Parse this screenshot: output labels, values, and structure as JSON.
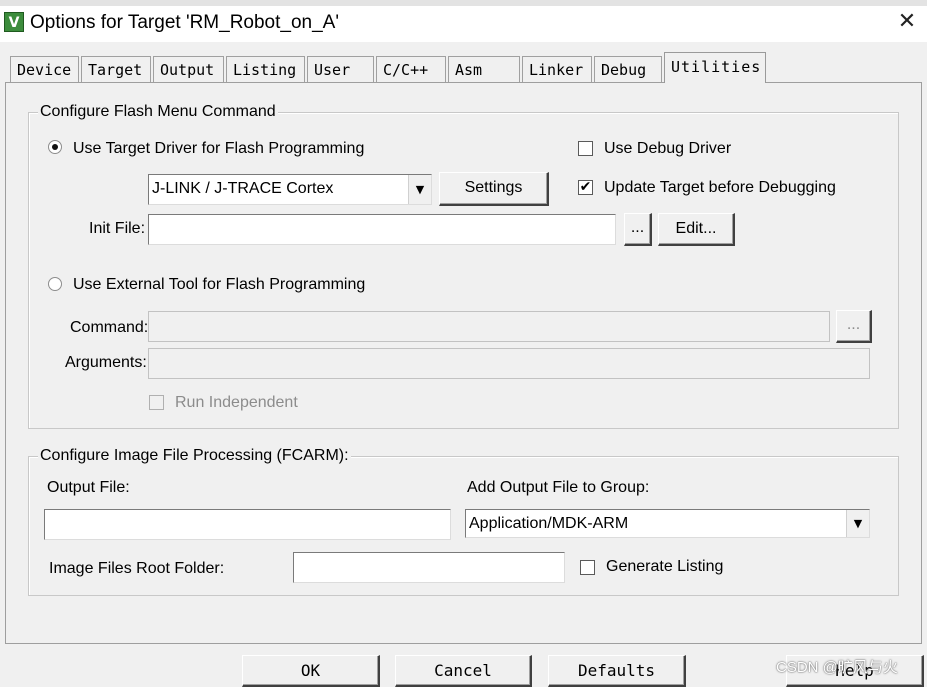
{
  "window": {
    "title": "Options for Target 'RM_Robot_on_A'",
    "close_glyph": "✕"
  },
  "tabs": [
    {
      "label": "Device"
    },
    {
      "label": "Target"
    },
    {
      "label": "Output"
    },
    {
      "label": "Listing"
    },
    {
      "label": "User"
    },
    {
      "label": "C/C++"
    },
    {
      "label": "Asm"
    },
    {
      "label": "Linker"
    },
    {
      "label": "Debug"
    },
    {
      "label": "Utilities",
      "active": true
    }
  ],
  "flash": {
    "group_label": "Configure Flash Menu Command",
    "use_target_driver": "Use Target Driver for Flash Programming",
    "driver_select": "J-LINK / J-TRACE Cortex",
    "settings_button": "Settings",
    "use_debug_driver": "Use Debug Driver",
    "update_target": "Update Target before Debugging",
    "update_target_checked": true,
    "init_file_label": "Init File:",
    "init_file_value": "",
    "browse_button": "...",
    "edit_button": "Edit...",
    "use_external_tool": "Use External Tool for Flash Programming",
    "command_label": "Command:",
    "command_value": "",
    "arguments_label": "Arguments:",
    "arguments_value": "",
    "run_independent": "Run Independent"
  },
  "image": {
    "group_label": "Configure Image File Processing (FCARM):",
    "output_file_label": "Output File:",
    "output_file_value": "",
    "add_output_label": "Add Output File  to Group:",
    "group_select": "Application/MDK-ARM",
    "root_folder_label": "Image Files Root Folder:",
    "root_folder_value": "",
    "generate_listing": "Generate Listing"
  },
  "footer": {
    "ok": "OK",
    "cancel": "Cancel",
    "defaults": "Defaults",
    "help": "Help"
  },
  "watermark": "CSDN @旷风与火",
  "check_glyph": "✔",
  "dropdown_glyph": "▼",
  "icons": {
    "app": "keil-uvision-icon",
    "close": "close-icon"
  }
}
